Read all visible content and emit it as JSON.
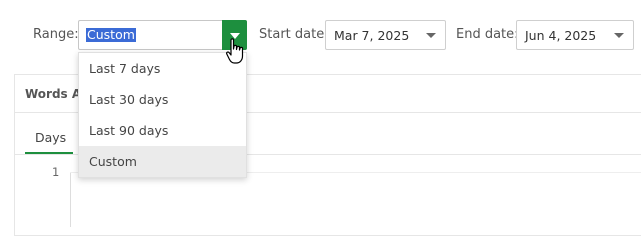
{
  "range": {
    "label": "Range:",
    "selected": "Custom",
    "options": [
      "Last 7 days",
      "Last 30 days",
      "Last 90 days",
      "Custom"
    ]
  },
  "start_date": {
    "label": "Start date:",
    "value": "Mar 7, 2025"
  },
  "end_date": {
    "label": "End date:",
    "value": "Jun 4, 2025"
  },
  "panel": {
    "title": "Words Ac",
    "tabs": [
      "Days"
    ],
    "y_tick": "1"
  },
  "colors": {
    "accent": "#1d8f3e",
    "selection": "#3b6bd6"
  },
  "icons": {
    "cursor": "hand-pointer-icon",
    "caret": "chevron-down-icon"
  }
}
